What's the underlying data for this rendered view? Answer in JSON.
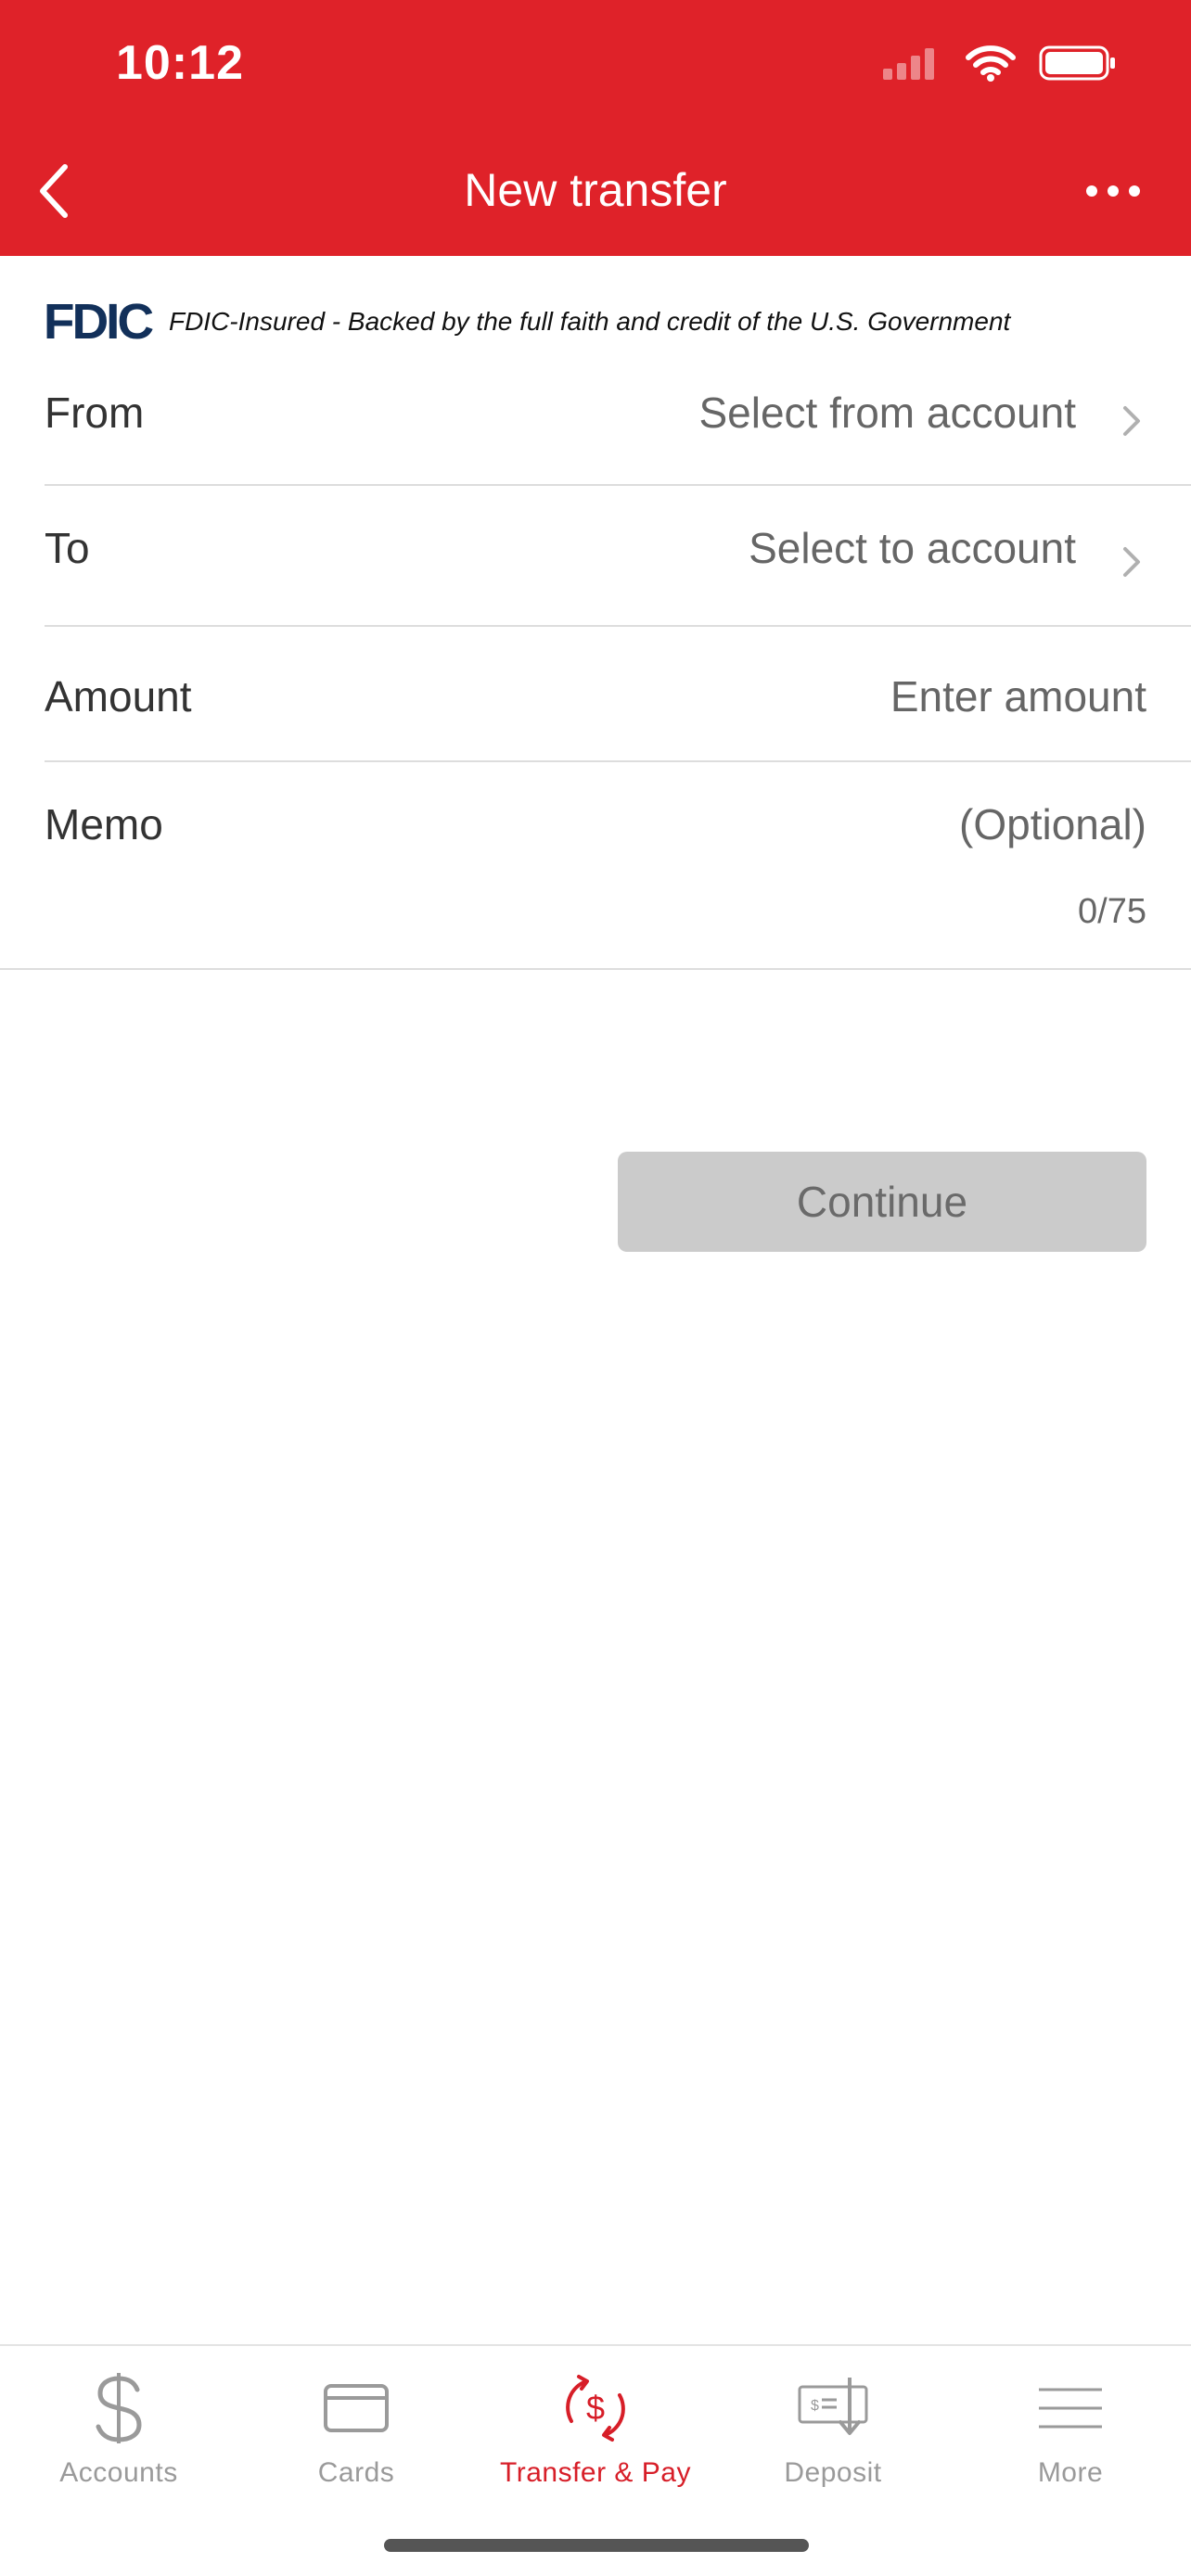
{
  "status_bar": {
    "time": "10:12"
  },
  "nav": {
    "title": "New transfer"
  },
  "fdic": {
    "logo": "FDIC",
    "text": "FDIC-Insured - Backed by the full faith and credit of the U.S. Government"
  },
  "form": {
    "from": {
      "label": "From",
      "value": "Select from account"
    },
    "to": {
      "label": "To",
      "value": "Select to account"
    },
    "amount": {
      "label": "Amount",
      "placeholder": "Enter amount"
    },
    "memo": {
      "label": "Memo",
      "placeholder": "(Optional)",
      "counter": "0/75"
    },
    "continue_label": "Continue"
  },
  "tabs": [
    {
      "label": "Accounts",
      "icon": "dollar-icon",
      "active": false
    },
    {
      "label": "Cards",
      "icon": "card-icon",
      "active": false
    },
    {
      "label": "Transfer & Pay",
      "icon": "transfer-icon",
      "active": true
    },
    {
      "label": "Deposit",
      "icon": "check-deposit-icon",
      "active": false
    },
    {
      "label": "More",
      "icon": "menu-icon",
      "active": false
    }
  ],
  "colors": {
    "brand_red": "#df2229",
    "active_tab": "#d71e28",
    "inactive_tab": "#9a9a9a",
    "fdic_navy": "#12305a",
    "button_disabled": "#cbcbcb"
  }
}
